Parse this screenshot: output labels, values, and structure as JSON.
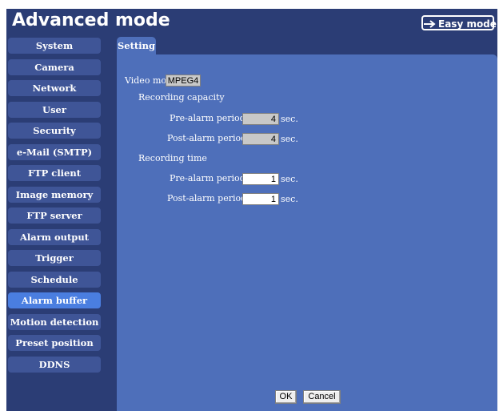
{
  "header": {
    "title": "Advanced mode",
    "easy_mode_label": "Easy mode",
    "easy_mode_icon": "right-arrow-icon"
  },
  "sidebar": {
    "items": [
      {
        "label": "System"
      },
      {
        "label": "Camera"
      },
      {
        "label": "Network"
      },
      {
        "label": "User"
      },
      {
        "label": "Security"
      },
      {
        "label": "e-Mail (SMTP)"
      },
      {
        "label": "FTP client"
      },
      {
        "label": "Image memory"
      },
      {
        "label": "FTP server"
      },
      {
        "label": "Alarm output"
      },
      {
        "label": "Trigger"
      },
      {
        "label": "Schedule"
      },
      {
        "label": "Alarm buffer",
        "active": true
      },
      {
        "label": "Motion detection"
      },
      {
        "label": "Preset position"
      },
      {
        "label": "DDNS"
      }
    ]
  },
  "tab": {
    "label": "Setting"
  },
  "settings": {
    "video_mode_label": "Video mode",
    "video_mode_value": "MPEG4",
    "recording_capacity": {
      "heading": "Recording capacity",
      "pre_label": "Pre-alarm period",
      "pre_value": "4",
      "post_label": "Post-alarm period",
      "post_value": "4",
      "unit": "sec."
    },
    "recording_time": {
      "heading": "Recording time",
      "pre_label": "Pre-alarm period",
      "pre_value": "1",
      "post_label": "Post-alarm period",
      "post_value": "1",
      "unit": "sec."
    }
  },
  "buttons": {
    "ok": "OK",
    "cancel": "Cancel"
  },
  "colors": {
    "background": "#2b3d75",
    "panel": "#4e6fba",
    "sidebar_item": "#3f5597",
    "sidebar_active": "#4a7ee0"
  }
}
